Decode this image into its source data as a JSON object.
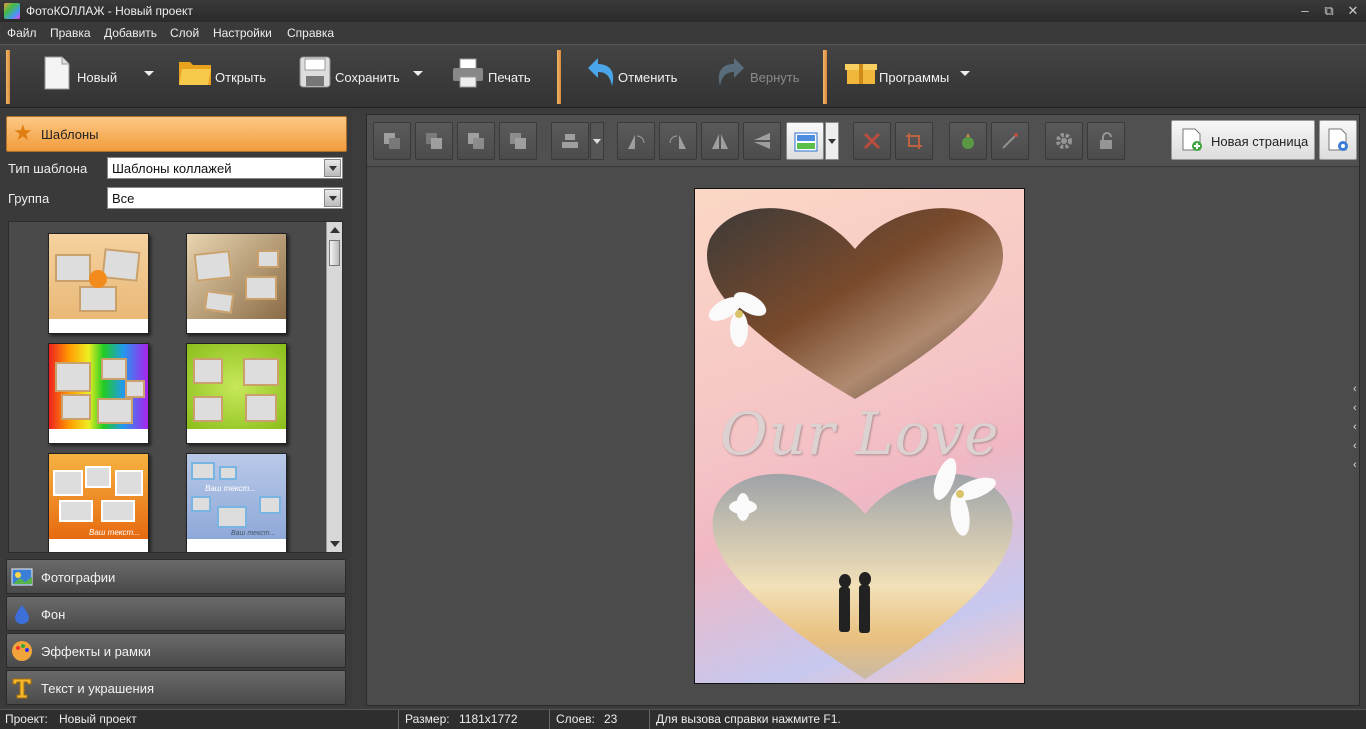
{
  "window": {
    "title": "ФотоКОЛЛАЖ - Новый проект",
    "minimize": "–",
    "restore": "⧉",
    "close": "✕"
  },
  "menu": [
    "Файл",
    "Правка",
    "Добавить",
    "Слой",
    "Настройки",
    "Справка"
  ],
  "toolbar": {
    "new_label": "Новый",
    "open_label": "Открыть",
    "save_label": "Сохранить",
    "print_label": "Печать",
    "undo_label": "Отменить",
    "redo_label": "Вернуть",
    "programs_label": "Программы"
  },
  "left_panel": {
    "templates_header": "Шаблоны",
    "template_type_label": "Тип шаблона",
    "template_type_value": "Шаблоны коллажей",
    "group_label": "Группа",
    "group_value": "Все",
    "thumb_text": "Ваш текст...",
    "sections": [
      "Фотографии",
      "Фон",
      "Эффекты и рамки",
      "Текст и украшения"
    ]
  },
  "canvas_toolbar": {
    "new_page_label": "Новая страница"
  },
  "canvas": {
    "overlay_text": "Our Love"
  },
  "right_collapse_arrows": [
    "‹",
    "‹",
    "‹",
    "‹",
    "‹"
  ],
  "status": {
    "project_label": "Проект:",
    "project_value": "Новый проект",
    "size_label": "Размер:",
    "size_value": "1181x1772",
    "layers_label": "Слоев:",
    "layers_value": "23",
    "hint": "Для вызова справки нажмите F1."
  },
  "colors": {
    "accent": "#f19c3c",
    "panel_bg": "#3c3c3c",
    "canvas_bg": "#4b4b4b"
  }
}
